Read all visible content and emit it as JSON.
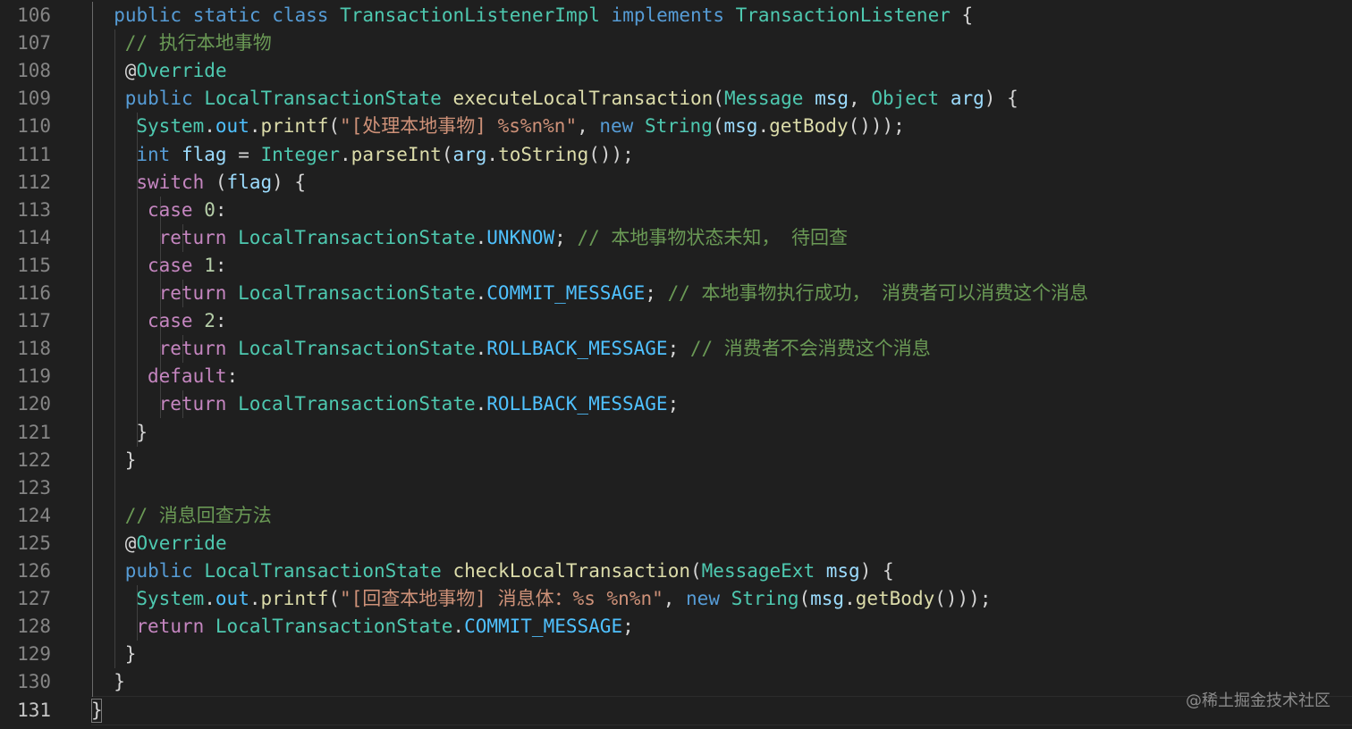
{
  "editor": {
    "active_line": "131",
    "line_numbers": [
      "106",
      "107",
      "108",
      "109",
      "110",
      "111",
      "112",
      "113",
      "114",
      "115",
      "116",
      "117",
      "118",
      "119",
      "120",
      "121",
      "122",
      "123",
      "124",
      "125",
      "126",
      "127",
      "128",
      "129",
      "130",
      "131"
    ],
    "lines": [
      [
        [
          "public",
          "kw"
        ],
        [
          " ",
          "pn"
        ],
        [
          "static",
          "kw"
        ],
        [
          " ",
          "pn"
        ],
        [
          "class",
          "kw"
        ],
        [
          " ",
          "pn"
        ],
        [
          "TransactionListenerImpl",
          "ty"
        ],
        [
          " ",
          "pn"
        ],
        [
          "implements",
          "kw"
        ],
        [
          " ",
          "pn"
        ],
        [
          "TransactionListener",
          "ty"
        ],
        [
          " ",
          "pn"
        ],
        [
          "{",
          "pn"
        ]
      ],
      [
        [
          "// 执行本地事物",
          "cm"
        ]
      ],
      [
        [
          "@",
          "pn"
        ],
        [
          "Override",
          "ty"
        ]
      ],
      [
        [
          "public",
          "kw"
        ],
        [
          " ",
          "pn"
        ],
        [
          "LocalTransactionState",
          "ty"
        ],
        [
          " ",
          "pn"
        ],
        [
          "executeLocalTransaction",
          "fn"
        ],
        [
          "(",
          "pn"
        ],
        [
          "Message",
          "ty"
        ],
        [
          " ",
          "pn"
        ],
        [
          "msg",
          "var"
        ],
        [
          ", ",
          "pn"
        ],
        [
          "Object",
          "ty"
        ],
        [
          " ",
          "pn"
        ],
        [
          "arg",
          "var"
        ],
        [
          ") {",
          "pn"
        ]
      ],
      [
        [
          "System",
          "ty"
        ],
        [
          ".",
          "pn"
        ],
        [
          "out",
          "cst"
        ],
        [
          ".",
          "pn"
        ],
        [
          "printf",
          "fn"
        ],
        [
          "(",
          "pn"
        ],
        [
          "\"[处理本地事物] %s%n%n\"",
          "str"
        ],
        [
          ", ",
          "pn"
        ],
        [
          "new",
          "kw"
        ],
        [
          " ",
          "pn"
        ],
        [
          "String",
          "ty"
        ],
        [
          "(",
          "pn"
        ],
        [
          "msg",
          "var"
        ],
        [
          ".",
          "pn"
        ],
        [
          "getBody",
          "fn"
        ],
        [
          "()));",
          "pn"
        ]
      ],
      [
        [
          "int",
          "kw"
        ],
        [
          " ",
          "pn"
        ],
        [
          "flag",
          "var"
        ],
        [
          " = ",
          "pn"
        ],
        [
          "Integer",
          "ty"
        ],
        [
          ".",
          "pn"
        ],
        [
          "parseInt",
          "fn"
        ],
        [
          "(",
          "pn"
        ],
        [
          "arg",
          "var"
        ],
        [
          ".",
          "pn"
        ],
        [
          "toString",
          "fn"
        ],
        [
          "());",
          "pn"
        ]
      ],
      [
        [
          "switch",
          "ctl"
        ],
        [
          " (",
          "pn"
        ],
        [
          "flag",
          "var"
        ],
        [
          ") {",
          "pn"
        ]
      ],
      [
        [
          "case",
          "ctl"
        ],
        [
          " ",
          "pn"
        ],
        [
          "0",
          "num"
        ],
        [
          ":",
          "pn"
        ]
      ],
      [
        [
          "return",
          "ctl"
        ],
        [
          " ",
          "pn"
        ],
        [
          "LocalTransactionState",
          "ty"
        ],
        [
          ".",
          "pn"
        ],
        [
          "UNKNOW",
          "cst"
        ],
        [
          "; ",
          "pn"
        ],
        [
          "// 本地事物状态未知， 待回查",
          "cm"
        ]
      ],
      [
        [
          "case",
          "ctl"
        ],
        [
          " ",
          "pn"
        ],
        [
          "1",
          "num"
        ],
        [
          ":",
          "pn"
        ]
      ],
      [
        [
          "return",
          "ctl"
        ],
        [
          " ",
          "pn"
        ],
        [
          "LocalTransactionState",
          "ty"
        ],
        [
          ".",
          "pn"
        ],
        [
          "COMMIT_MESSAGE",
          "cst"
        ],
        [
          "; ",
          "pn"
        ],
        [
          "// 本地事物执行成功， 消费者可以消费这个消息",
          "cm"
        ]
      ],
      [
        [
          "case",
          "ctl"
        ],
        [
          " ",
          "pn"
        ],
        [
          "2",
          "num"
        ],
        [
          ":",
          "pn"
        ]
      ],
      [
        [
          "return",
          "ctl"
        ],
        [
          " ",
          "pn"
        ],
        [
          "LocalTransactionState",
          "ty"
        ],
        [
          ".",
          "pn"
        ],
        [
          "ROLLBACK_MESSAGE",
          "cst"
        ],
        [
          "; ",
          "pn"
        ],
        [
          "// 消费者不会消费这个消息",
          "cm"
        ]
      ],
      [
        [
          "default",
          "ctl"
        ],
        [
          ":",
          "pn"
        ]
      ],
      [
        [
          "return",
          "ctl"
        ],
        [
          " ",
          "pn"
        ],
        [
          "LocalTransactionState",
          "ty"
        ],
        [
          ".",
          "pn"
        ],
        [
          "ROLLBACK_MESSAGE",
          "cst"
        ],
        [
          ";",
          "pn"
        ]
      ],
      [
        [
          "}",
          "pn"
        ]
      ],
      [
        [
          "}",
          "pn"
        ]
      ],
      [],
      [
        [
          "// 消息回查方法",
          "cm"
        ]
      ],
      [
        [
          "@",
          "pn"
        ],
        [
          "Override",
          "ty"
        ]
      ],
      [
        [
          "public",
          "kw"
        ],
        [
          " ",
          "pn"
        ],
        [
          "LocalTransactionState",
          "ty"
        ],
        [
          " ",
          "pn"
        ],
        [
          "checkLocalTransaction",
          "fn"
        ],
        [
          "(",
          "pn"
        ],
        [
          "MessageExt",
          "ty"
        ],
        [
          " ",
          "pn"
        ],
        [
          "msg",
          "var"
        ],
        [
          ") {",
          "pn"
        ]
      ],
      [
        [
          "System",
          "ty"
        ],
        [
          ".",
          "pn"
        ],
        [
          "out",
          "cst"
        ],
        [
          ".",
          "pn"
        ],
        [
          "printf",
          "fn"
        ],
        [
          "(",
          "pn"
        ],
        [
          "\"[回查本地事物] 消息体：%s %n%n\"",
          "str"
        ],
        [
          ", ",
          "pn"
        ],
        [
          "new",
          "kw"
        ],
        [
          " ",
          "pn"
        ],
        [
          "String",
          "ty"
        ],
        [
          "(",
          "pn"
        ],
        [
          "msg",
          "var"
        ],
        [
          ".",
          "pn"
        ],
        [
          "getBody",
          "fn"
        ],
        [
          "()));",
          "pn"
        ]
      ],
      [
        [
          "return",
          "ctl"
        ],
        [
          " ",
          "pn"
        ],
        [
          "LocalTransactionState",
          "ty"
        ],
        [
          ".",
          "pn"
        ],
        [
          "COMMIT_MESSAGE",
          "cst"
        ],
        [
          ";",
          "pn"
        ]
      ],
      [
        [
          "}",
          "pn"
        ]
      ],
      [
        [
          "}",
          "pn"
        ]
      ],
      [
        [
          "}",
          "pn"
        ]
      ]
    ]
  },
  "watermark": "@稀土掘金技术社区",
  "colors": {
    "background": "#1f1f1f",
    "keyword": "#569cd6",
    "control": "#c586c0",
    "type": "#4ec9b0",
    "function": "#dcdcaa",
    "variable": "#9cdcfe",
    "number": "#b5cea8",
    "string": "#ce9178",
    "comment": "#6a9955",
    "constant": "#4fc1ff",
    "line_number": "#858585"
  }
}
